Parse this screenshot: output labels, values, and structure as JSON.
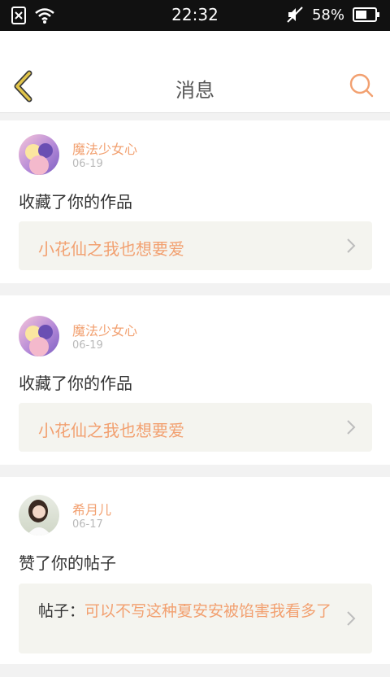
{
  "status_bar": {
    "time": "22:32",
    "battery": "58%",
    "icons": [
      "sim-blocked-icon",
      "wifi-icon",
      "mute-icon",
      "battery-icon"
    ]
  },
  "header": {
    "title": "消息",
    "back_icon": "chevron-left-icon",
    "search_icon": "search-icon"
  },
  "colors": {
    "accent": "#f2a070",
    "back_icon": "#e2c54a",
    "box_bg": "#f4f4ef"
  },
  "messages": [
    {
      "username": "魔法少女心",
      "date": "06-19",
      "action": "收藏了你的作品",
      "work_title": "小花仙之我也想要爱"
    },
    {
      "username": "魔法少女心",
      "date": "06-19",
      "action": "收藏了你的作品",
      "work_title": "小花仙之我也想要爱"
    },
    {
      "username": "希月儿",
      "date": "06-17",
      "action": "赞了你的帖子",
      "post_prefix": "帖子：",
      "post_title": "可以不写这种夏安安被馅害我看多了"
    }
  ]
}
